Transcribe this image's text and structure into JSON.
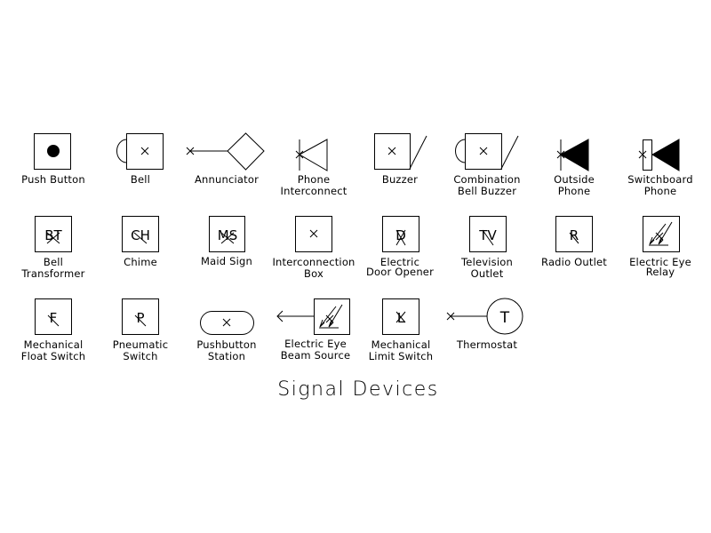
{
  "title": "Signal Devices",
  "symbols": [
    {
      "id": "push-button",
      "label_line1": "Push Button",
      "label_line2": ""
    },
    {
      "id": "bell",
      "label_line1": "Bell",
      "label_line2": ""
    },
    {
      "id": "annunciator",
      "label_line1": "Annunciator",
      "label_line2": ""
    },
    {
      "id": "phone-interconnect",
      "label_line1": "Phone",
      "label_line2": "Interconnect"
    },
    {
      "id": "buzzer",
      "label_line1": "Buzzer",
      "label_line2": ""
    },
    {
      "id": "combination-bell-buzzer",
      "label_line1": "Combination",
      "label_line2": "Bell Buzzer"
    },
    {
      "id": "outside-phone",
      "label_line1": "Outside",
      "label_line2": "Phone"
    },
    {
      "id": "switchboard-phone",
      "label_line1": "Switchboard",
      "label_line2": "Phone"
    },
    {
      "id": "bell-transformer",
      "label_line1": "Bell",
      "label_line2": "Transformer",
      "glyph": "BT"
    },
    {
      "id": "chime",
      "label_line1": "Chime",
      "label_line2": "",
      "glyph": "CH"
    },
    {
      "id": "maid-sign",
      "label_line1": "Maid Sign",
      "label_line2": "",
      "glyph": "MS"
    },
    {
      "id": "interconnection-box",
      "label_line1": "Interconnection",
      "label_line2": "Box"
    },
    {
      "id": "electric-door-opener",
      "label_line1": "Electric",
      "label_line2": "Door Opener",
      "glyph": "D"
    },
    {
      "id": "television-outlet",
      "label_line1": "Television",
      "label_line2": "Outlet",
      "glyph": "TV"
    },
    {
      "id": "radio-outlet",
      "label_line1": "Radio Outlet",
      "label_line2": "",
      "glyph": "R"
    },
    {
      "id": "electric-eye-relay",
      "label_line1": "Electric Eye",
      "label_line2": "Relay"
    },
    {
      "id": "mechanical-float-switch",
      "label_line1": "Mechanical",
      "label_line2": "Float Switch",
      "glyph": "F"
    },
    {
      "id": "pneumatic-switch",
      "label_line1": "Pneumatic",
      "label_line2": "Switch",
      "glyph": "P"
    },
    {
      "id": "pushbutton-station",
      "label_line1": "Pushbutton",
      "label_line2": "Station"
    },
    {
      "id": "electric-eye-beam-source",
      "label_line1": "Electric Eye",
      "label_line2": "Beam Source"
    },
    {
      "id": "mechanical-limit-switch",
      "label_line1": "Mechanical",
      "label_line2": "Limit Switch",
      "glyph": "L"
    },
    {
      "id": "thermostat",
      "label_line1": "Thermostat",
      "label_line2": "",
      "glyph": "T"
    }
  ]
}
